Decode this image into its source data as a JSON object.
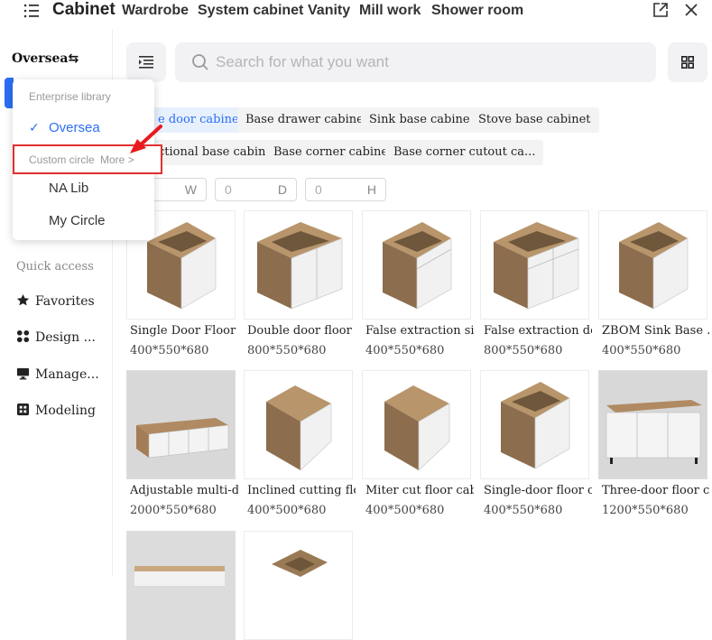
{
  "topbar": {
    "title": "Cabinet",
    "categories": [
      "Wardrobe",
      "System cabinet",
      "Vanity",
      "Mill work",
      "Shower room"
    ]
  },
  "sidebar": {
    "library_title": "Oversea",
    "quick_access_label": "Quick access",
    "items": [
      {
        "label": "Favorites",
        "icon": "star-icon"
      },
      {
        "label": "Design ...",
        "icon": "design-icon"
      },
      {
        "label": "Manage...",
        "icon": "monitor-icon"
      },
      {
        "label": "Modeling",
        "icon": "modeling-icon"
      }
    ]
  },
  "dropdown": {
    "enterprise_header": "Enterprise library",
    "oversea_label": "Oversea",
    "custom_circle_label": "Custom circle",
    "more_label": "More",
    "na_lib_label": "NA Lib",
    "my_circle_label": "My Circle"
  },
  "search": {
    "placeholder": "Search for what you want"
  },
  "tags": [
    "e door cabinet",
    "Base drawer cabinet",
    "Sink base cabinet",
    "Stove base cabinet",
    "ctional base cabinet",
    "Base corner cabinet",
    "Base corner cutout ca..."
  ],
  "dimensions": {
    "w": {
      "value": "",
      "unit": "W"
    },
    "d": {
      "value": "0",
      "unit": "D"
    },
    "h": {
      "value": "0",
      "unit": "H"
    }
  },
  "products": [
    {
      "name": "Single Door Floor ...",
      "size": "400*550*680"
    },
    {
      "name": "Double door floor c...",
      "size": "800*550*680"
    },
    {
      "name": "False extraction sin...",
      "size": "400*550*680"
    },
    {
      "name": "False extraction do...",
      "size": "800*550*680"
    },
    {
      "name": "ZBOM Sink Base ...",
      "size": "400*550*680"
    },
    {
      "name": "Adjustable multi-do...",
      "size": "2000*550*680"
    },
    {
      "name": "Inclined cutting flo...",
      "size": "400*500*680"
    },
    {
      "name": "Miter cut floor cabi...",
      "size": "400*500*680"
    },
    {
      "name": "Single-door floor c...",
      "size": "400*550*680"
    },
    {
      "name": "Three-door floor ca...",
      "size": "1200*550*680"
    }
  ],
  "colors": {
    "accent": "#2b6ef5",
    "highlight_box": "#e03030",
    "wood": "#8c6d4e",
    "door": "#f1f1f1"
  }
}
